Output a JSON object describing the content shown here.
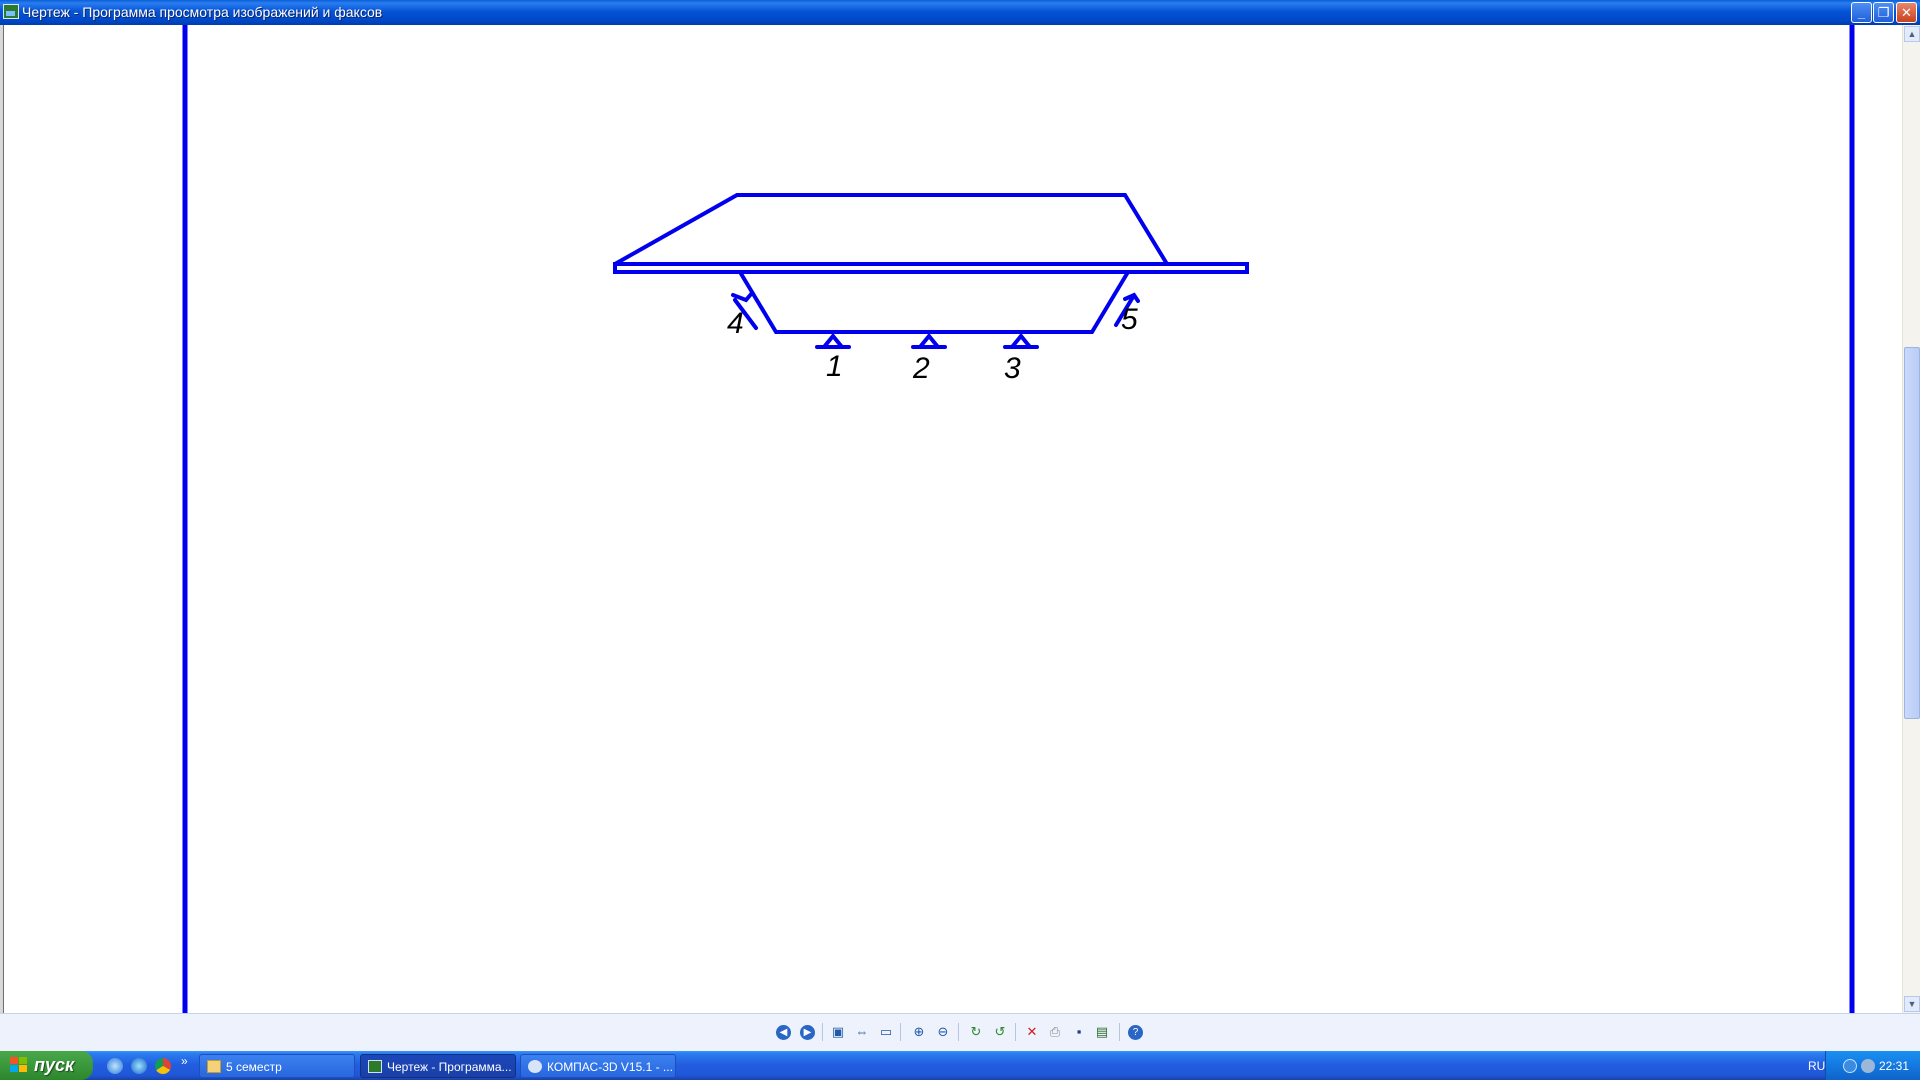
{
  "window": {
    "title": "Чертеж - Программа просмотра изображений и факсов",
    "buttons": {
      "minimize": "_",
      "maximize": "❐",
      "close": "✕"
    }
  },
  "drawing": {
    "stroke_color": "#0000ee",
    "labels": [
      "1",
      "2",
      "3",
      "4",
      "5"
    ]
  },
  "viewer_toolbar": {
    "buttons": [
      "previous-image",
      "next-image",
      "best-fit",
      "actual-size",
      "slideshow",
      "zoom-in",
      "zoom-out",
      "rotate-clockwise",
      "rotate-counterclockwise",
      "delete",
      "print",
      "save-as",
      "open-for-editing",
      "help"
    ]
  },
  "taskbar": {
    "start_label": "пуск",
    "quick_launch": [
      "show-desktop",
      "internet-explorer",
      "chrome"
    ],
    "quick_launch_more": "»",
    "tasks": [
      {
        "label": "5 семестр",
        "icon": "folder",
        "active": false
      },
      {
        "label": "Чертеж - Программа...",
        "icon": "image-viewer",
        "active": true
      },
      {
        "label": "КОМПАС-3D V15.1 - ...",
        "icon": "kompas",
        "active": false
      }
    ],
    "language": "RU",
    "clock": "22:31"
  }
}
